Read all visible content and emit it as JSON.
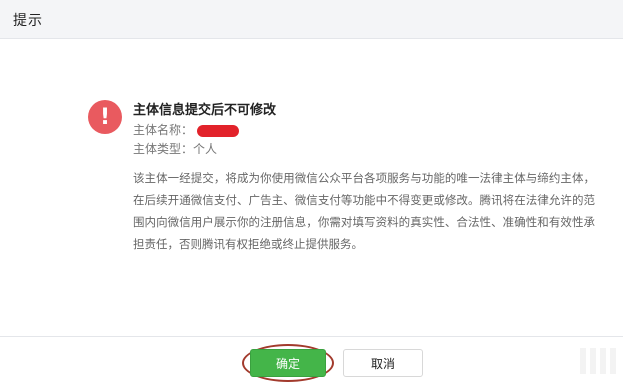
{
  "dialog": {
    "title": "提示",
    "headline": "主体信息提交后不可修改",
    "entity_name_label": "主体名称：",
    "entity_type_label": "主体类型：",
    "entity_type_value": "个人",
    "description": "该主体一经提交，将成为你使用微信公众平台各项服务与功能的唯一法律主体与缔约主体，在后续开通微信支付、广告主、微信支付等功能中不得变更或修改。腾讯将在法律允许的范围内向微信用户展示你的注册信息，你需对填写资料的真实性、合法性、准确性和有效性承担责任，否则腾讯有权拒绝或终止提供服务。",
    "confirm_label": "确定",
    "cancel_label": "取消"
  },
  "icons": {
    "warning": "exclamation-icon"
  },
  "colors": {
    "warning": "#e95a5f",
    "confirm": "#44b549",
    "redaction": "#e2222a"
  }
}
